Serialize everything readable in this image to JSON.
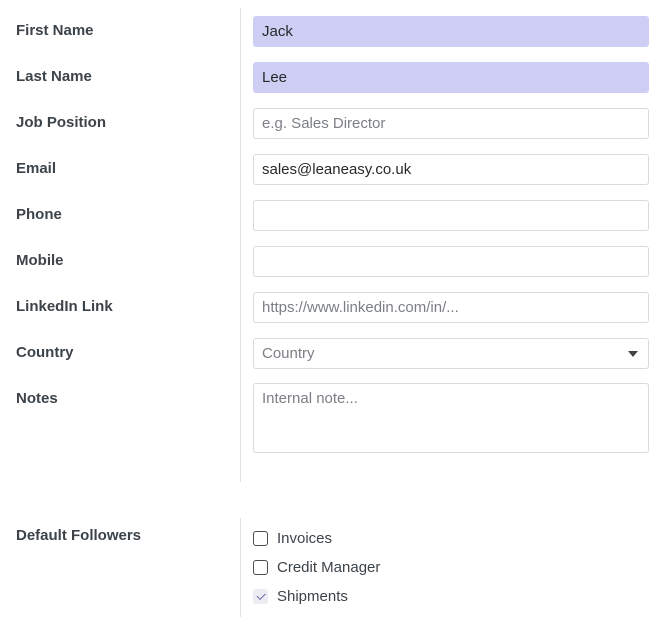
{
  "form": {
    "contact_group": {
      "rows": [
        {
          "label": "First Name",
          "type": "text",
          "value": "Jack",
          "placeholder": "",
          "highlighted": true
        },
        {
          "label": "Last Name",
          "type": "text",
          "value": "Lee",
          "placeholder": "",
          "highlighted": true
        },
        {
          "label": "Job Position",
          "type": "text",
          "value": "",
          "placeholder": "e.g. Sales Director",
          "highlighted": false
        },
        {
          "label": "Email",
          "type": "text",
          "value": "sales@leaneasy.co.uk",
          "placeholder": "",
          "highlighted": false
        },
        {
          "label": "Phone",
          "type": "text",
          "value": "",
          "placeholder": "",
          "highlighted": false
        },
        {
          "label": "Mobile",
          "type": "text",
          "value": "",
          "placeholder": "",
          "highlighted": false
        },
        {
          "label": "LinkedIn Link",
          "type": "text",
          "value": "",
          "placeholder": "https://www.linkedin.com/in/...",
          "highlighted": false
        },
        {
          "label": "Country",
          "type": "select",
          "value": "",
          "placeholder": "Country",
          "highlighted": false
        },
        {
          "label": "Notes",
          "type": "textarea",
          "value": "",
          "placeholder": "Internal note...",
          "highlighted": false
        }
      ]
    },
    "followers_group": {
      "label": "Default Followers",
      "options": [
        {
          "label": "Invoices",
          "checked": false
        },
        {
          "label": "Credit Manager",
          "checked": false
        },
        {
          "label": "Shipments",
          "checked": true
        }
      ]
    },
    "colors": {
      "highlight_field_bg": "#cecef4",
      "field_border": "#d8dadd",
      "label_text": "#3c4349",
      "placeholder_text": "#7b7f85",
      "value_text": "#26282b",
      "divider": "#dee2e6",
      "checkbox_border": "#4a4f55",
      "checkbox_checked_bg": "#ececf2",
      "checkmark": "#6b6ba8"
    }
  }
}
